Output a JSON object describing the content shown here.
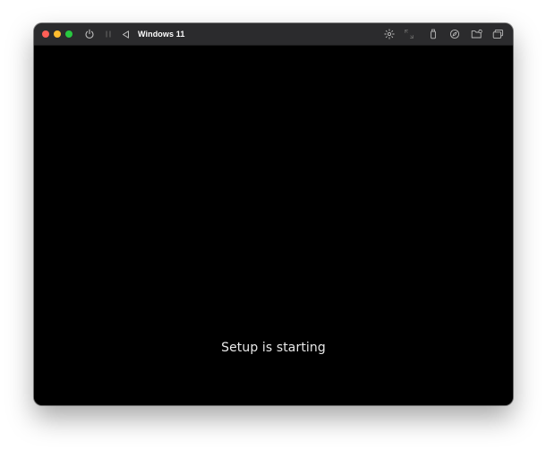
{
  "window": {
    "title": "Windows 11"
  },
  "traffic_lights": {
    "close_color": "#ff5f57",
    "minimize_color": "#febc2e",
    "zoom_color": "#28c840"
  },
  "toolbar": {
    "left_icons": [
      "power-icon",
      "pause-icon",
      "back-triangle-icon"
    ],
    "right_icons": [
      "brightness-icon",
      "resize-icon",
      "usb-icon",
      "shared-folder-compass-icon",
      "folder-icon",
      "windows-icon"
    ]
  },
  "screen": {
    "message": "Setup is starting",
    "background": "#000000"
  }
}
